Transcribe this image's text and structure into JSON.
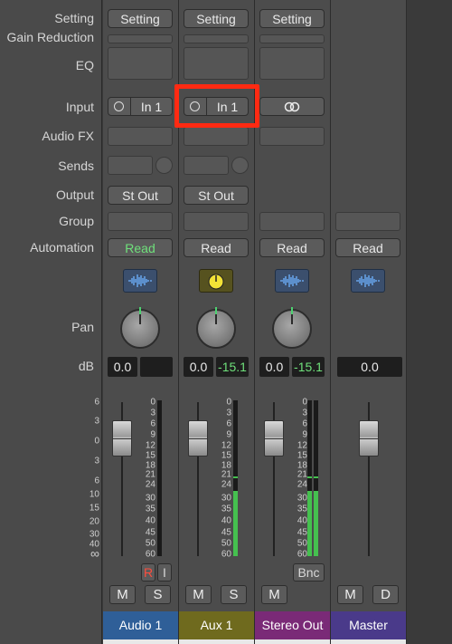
{
  "row_labels": {
    "setting": "Setting",
    "gain_reduction": "Gain Reduction",
    "eq": "EQ",
    "input": "Input",
    "audio_fx": "Audio FX",
    "sends": "Sends",
    "output": "Output",
    "group": "Group",
    "automation": "Automation",
    "pan": "Pan",
    "db": "dB"
  },
  "fader_scale": [
    "6",
    "3",
    "0",
    "3",
    "6",
    "10",
    "15",
    "20",
    "30",
    "40",
    "∞"
  ],
  "meter_scale": [
    "0",
    "3",
    "6",
    "9",
    "12",
    "15",
    "18",
    "21",
    "24",
    "30",
    "35",
    "40",
    "45",
    "50",
    "60"
  ],
  "channels": [
    {
      "name": "Audio 1",
      "color": "#2f5f98",
      "setting": "Setting",
      "input": "In 1",
      "output": "St Out",
      "automation": "Read",
      "automation_active": true,
      "plugin_icon": "waveform-icon",
      "db_volume": "0.0",
      "db_peak": "",
      "meter_level": 0,
      "record_label": "R",
      "input_monitor_label": "I",
      "mute_label": "M",
      "solo_label": "S"
    },
    {
      "name": "Aux 1",
      "color": "#6f6a1e",
      "setting": "Setting",
      "input": "In 1",
      "output": "St Out",
      "automation": "Read",
      "automation_active": false,
      "plugin_icon": "tuner-icon",
      "db_volume": "0.0",
      "db_peak": "-15.1",
      "meter_level": 0.42,
      "mute_label": "M",
      "solo_label": "S"
    },
    {
      "name": "Stereo Out",
      "color": "#7a2a77",
      "setting": "Setting",
      "input": "",
      "input_icon": "stereo-link-icon",
      "automation": "Read",
      "automation_active": false,
      "plugin_icon": "waveform-icon",
      "db_volume": "0.0",
      "db_peak": "-15.1",
      "meter_level": 0.42,
      "bounce_label": "Bnc",
      "mute_label": "M"
    },
    {
      "name": "Master",
      "color": "#4a3a8a",
      "automation": "Read",
      "automation_active": false,
      "plugin_icon": "waveform-icon",
      "db_volume": "0.0",
      "mute_label": "M",
      "dim_label": "D"
    }
  ]
}
